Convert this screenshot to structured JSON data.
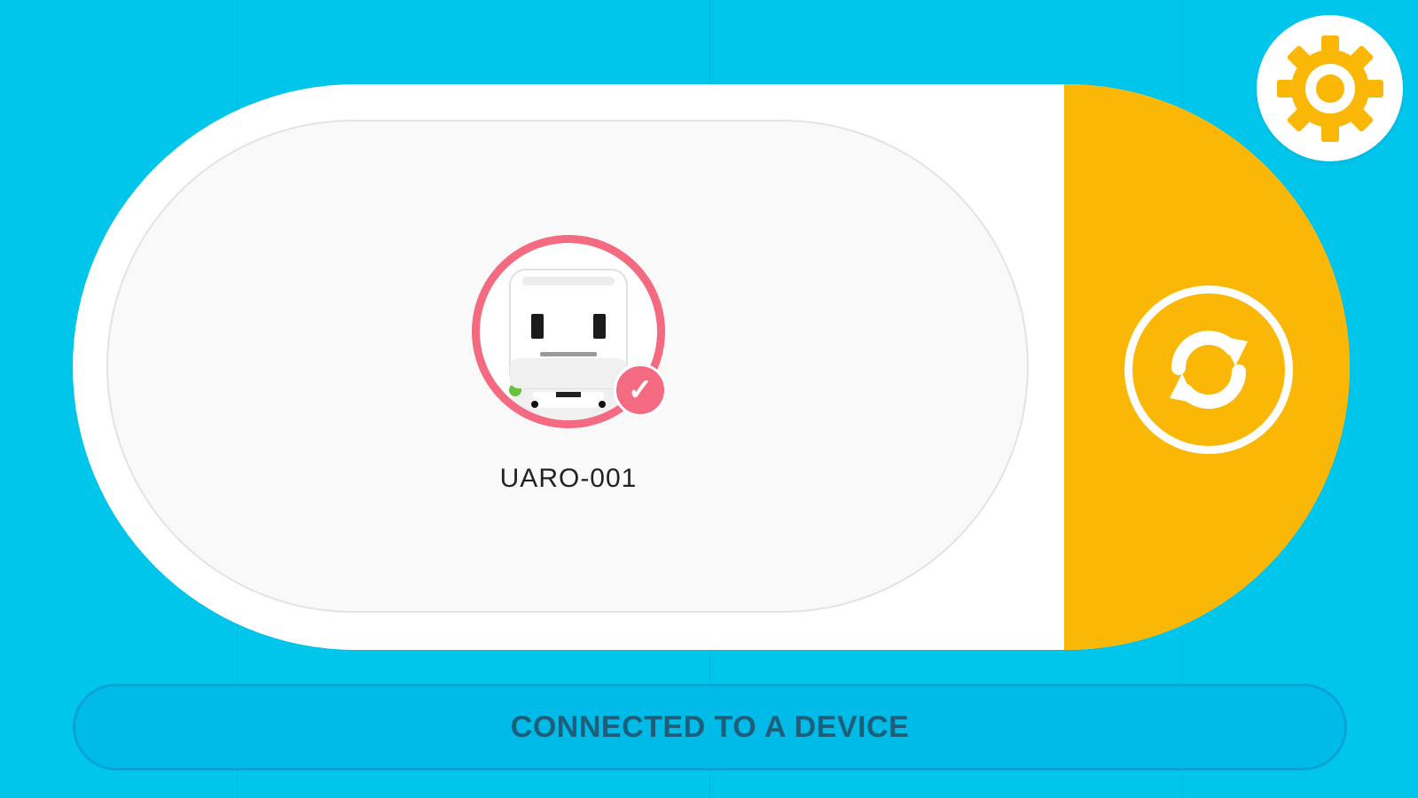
{
  "device": {
    "name": "UARO-001",
    "avatar_icon": "robot-face-icon",
    "status_icon": "check-icon"
  },
  "actions": {
    "refresh_icon": "refresh-icon",
    "settings_icon": "gear-icon"
  },
  "status": {
    "text": "CONNECTED TO A DEVICE"
  },
  "colors": {
    "background": "#00c6ec",
    "accent": "#fbb706",
    "selected": "#f46a81",
    "status_bar": "#00bbe8"
  }
}
